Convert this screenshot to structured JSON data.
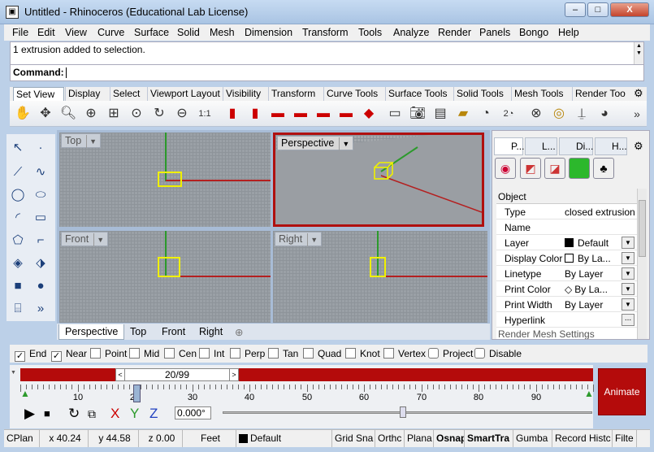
{
  "window": {
    "title": "Untitled - Rhinoceros (Educational Lab License)",
    "minimize": "–",
    "maximize": "□",
    "close": "X"
  },
  "menu": [
    "File",
    "Edit",
    "View",
    "Curve",
    "Surface",
    "Solid",
    "Mesh",
    "Dimension",
    "Transform",
    "Tools",
    "Analyze",
    "Render",
    "Panels",
    "Bongo",
    "Help"
  ],
  "output": {
    "message": "1 extrusion added to selection.",
    "command_label": "Command:"
  },
  "toolbar_tabs": [
    "Set View",
    "Display",
    "Select",
    "Viewport Layout",
    "Visibility",
    "Transform",
    "Curve Tools",
    "Surface Tools",
    "Solid Tools",
    "Mesh Tools",
    "Render Too"
  ],
  "toolbar_icons": [
    "pan-icon",
    "rotate-icon",
    "zoom-icon",
    "zoom-extents-icon",
    "zoom-window-icon",
    "zoom-selected-icon",
    "rotate-view-icon",
    "zoom-out-icon",
    "one-to-one-icon",
    "front-car-view-icon",
    "back-car-view-icon",
    "left-car-view-icon",
    "right-car-view-icon",
    "car-view-icon",
    "car-view-icon-2",
    "bottom-car-view-icon",
    "perspective-car-icon",
    "camera-icon",
    "save-view-icon",
    "restore-view-icon",
    "light-icon",
    "two-point-perspective-icon",
    "target-icon",
    "target-icon-2",
    "place-camera-icon",
    "camera-settings-icon"
  ],
  "viewports": {
    "top": "Top",
    "perspective": "Perspective",
    "front": "Front",
    "right": "Right"
  },
  "viewport_tabs": [
    "Perspective",
    "Top",
    "Front",
    "Right"
  ],
  "panel": {
    "tabs": [
      "P...",
      "L...",
      "Di...",
      "H..."
    ],
    "section": "Object",
    "rows": [
      {
        "name": "Type",
        "value": "closed extrusion"
      },
      {
        "name": "Name",
        "value": ""
      },
      {
        "name": "Layer",
        "value": "Default"
      },
      {
        "name": "Display Color",
        "value": "By La..."
      },
      {
        "name": "Linetype",
        "value": "By Layer"
      },
      {
        "name": "Print Color",
        "value": "By La..."
      },
      {
        "name": "Print Width",
        "value": "By Layer"
      },
      {
        "name": "Hyperlink",
        "value": ""
      },
      {
        "name": "Render Mesh Settings",
        "value": ""
      }
    ]
  },
  "osnap": [
    {
      "label": "End",
      "checked": true
    },
    {
      "label": "Near",
      "checked": true
    },
    {
      "label": "Point",
      "checked": false
    },
    {
      "label": "Mid",
      "checked": false
    },
    {
      "label": "Cen",
      "checked": false
    },
    {
      "label": "Int",
      "checked": false
    },
    {
      "label": "Perp",
      "checked": false
    },
    {
      "label": "Tan",
      "checked": false
    },
    {
      "label": "Quad",
      "checked": false
    },
    {
      "label": "Knot",
      "checked": false
    },
    {
      "label": "Vertex",
      "checked": false
    },
    {
      "label": "Project",
      "checked": false
    },
    {
      "label": "Disable",
      "checked": false
    }
  ],
  "animation": {
    "frame": "20/99",
    "ticks": [
      "10",
      "20",
      "30",
      "40",
      "50",
      "60",
      "70",
      "80",
      "90"
    ],
    "angle": "0.000°",
    "animate_label": "Animate",
    "accent": "#b40b0b"
  },
  "status": {
    "cplane": "CPlan",
    "x": "x 40.24",
    "y": "y 44.58",
    "z": "z 0.00",
    "units": "Feet",
    "layer": "Default",
    "toggles": [
      "Grid Sna",
      "Orthc",
      "Plana",
      "Osnap",
      "SmartTra",
      "Gumba",
      "Record Histc",
      "Filte"
    ]
  }
}
